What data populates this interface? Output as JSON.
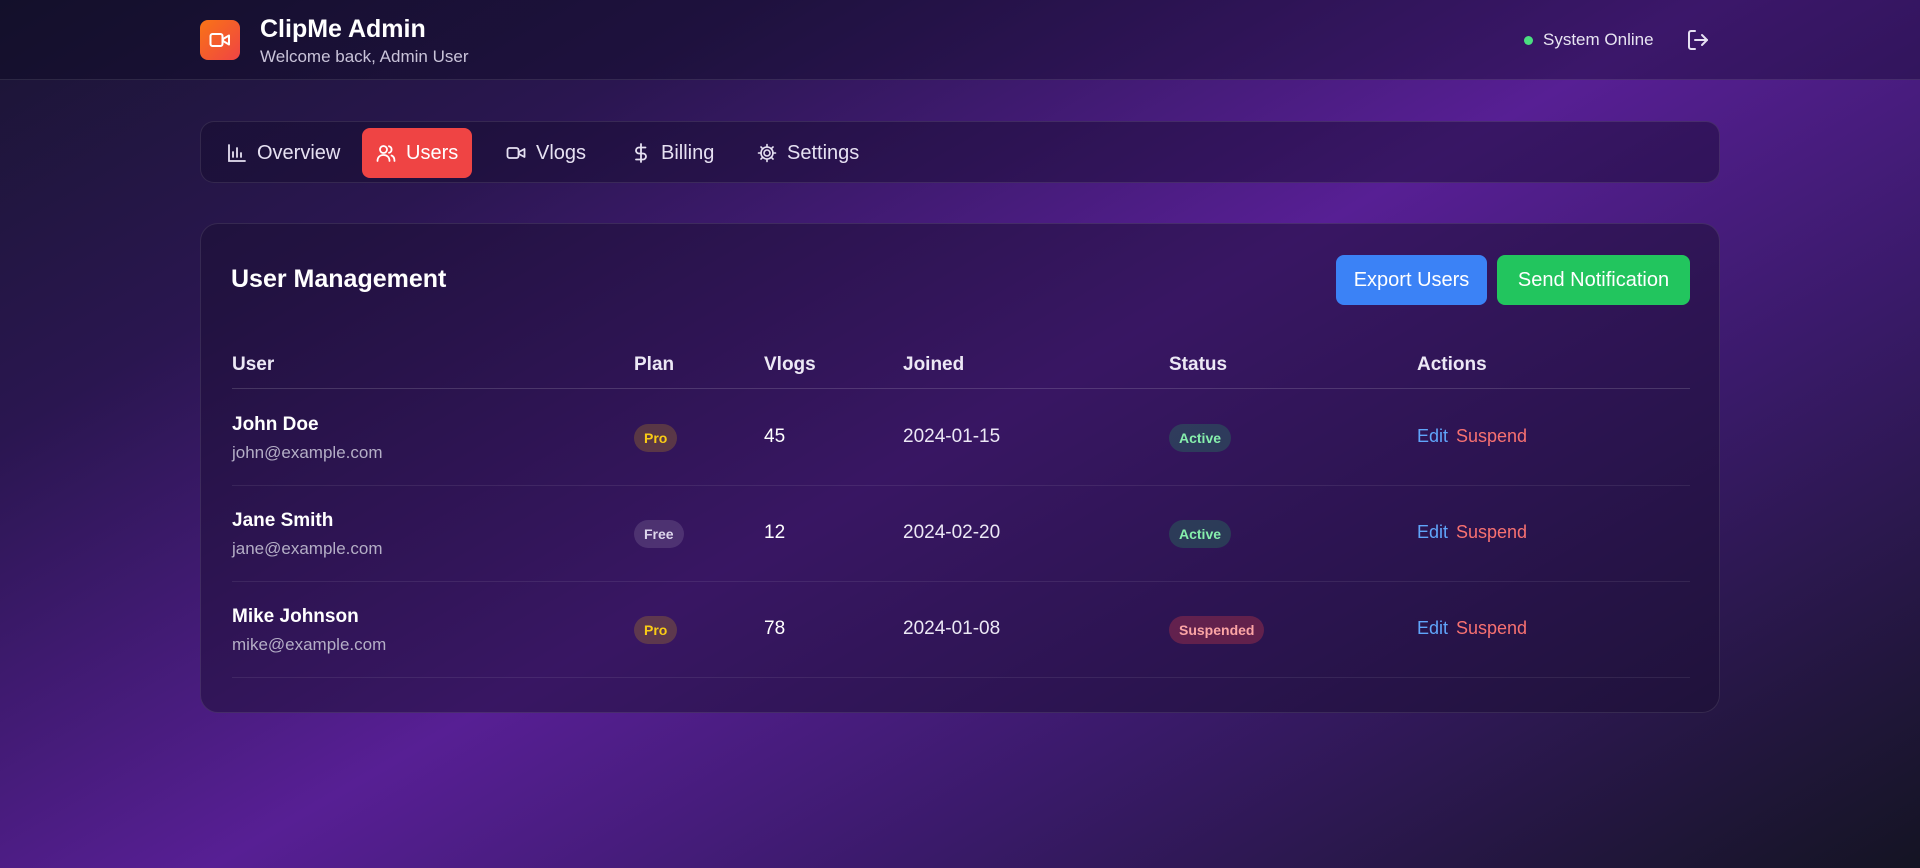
{
  "app": {
    "title": "ClipMe Admin",
    "subtitle": "Welcome back, Admin User",
    "logo_icon": "video-camera-icon",
    "status_text": "System Online",
    "status_color": "#4ade80"
  },
  "nav": {
    "tabs": [
      {
        "label": "Overview",
        "icon": "bar-chart-icon",
        "active": false
      },
      {
        "label": "Users",
        "icon": "users-icon",
        "active": true
      },
      {
        "label": "Vlogs",
        "icon": "video-camera-icon",
        "active": false
      },
      {
        "label": "Billing",
        "icon": "dollar-icon",
        "active": false
      },
      {
        "label": "Settings",
        "icon": "gear-icon",
        "active": false
      }
    ],
    "active_color": "#ef4444"
  },
  "users_card": {
    "title": "User Management",
    "export_label": "Export Users",
    "notify_label": "Send Notification",
    "columns": [
      "User",
      "Plan",
      "Vlogs",
      "Joined",
      "Status",
      "Actions"
    ],
    "rows": [
      {
        "name": "John Doe",
        "email": "john@example.com",
        "plan": "Pro",
        "vlogs": "45",
        "joined": "2024-01-15",
        "status": "Active",
        "edit": "Edit",
        "suspend": "Suspend"
      },
      {
        "name": "Jane Smith",
        "email": "jane@example.com",
        "plan": "Free",
        "vlogs": "12",
        "joined": "2024-02-20",
        "status": "Active",
        "edit": "Edit",
        "suspend": "Suspend"
      },
      {
        "name": "Mike Johnson",
        "email": "mike@example.com",
        "plan": "Pro",
        "vlogs": "78",
        "joined": "2024-01-08",
        "status": "Suspended",
        "edit": "Edit",
        "suspend": "Suspend"
      }
    ]
  },
  "colors": {
    "export_button": "#3b82f6",
    "notify_button": "#22c55e",
    "edit_link": "#60a5fa",
    "suspend_link": "#f87171"
  }
}
